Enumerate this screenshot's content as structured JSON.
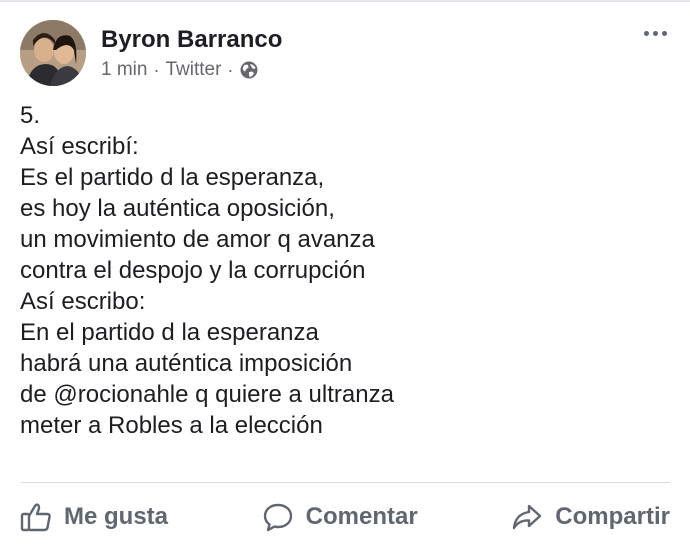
{
  "post": {
    "author_name": "Byron Barranco",
    "time": "1 min",
    "separator": "·",
    "source": "Twitter",
    "privacy_icon": "globe-icon",
    "more_icon": "more-options-icon",
    "lines": [
      "5.",
      "Así escribí:",
      "Es el partido d la esperanza,",
      "es hoy la auténtica oposición,",
      "un movimiento de amor q avanza",
      "contra el despojo y la corrupción",
      "Así escribo:",
      "En el partido d la esperanza",
      "habrá una auténtica imposición",
      "de @rocionahle q quiere a ultranza",
      "meter a Robles a la elección"
    ]
  },
  "actions": {
    "like_label": "Me gusta",
    "comment_label": "Comentar",
    "share_label": "Compartir",
    "like_icon": "thumbs-up-icon",
    "comment_icon": "comment-icon",
    "share_icon": "share-icon"
  },
  "colors": {
    "text": "#1c1e21",
    "secondary_text": "#65676b",
    "action_text": "#606770",
    "divider": "#dadde1"
  }
}
